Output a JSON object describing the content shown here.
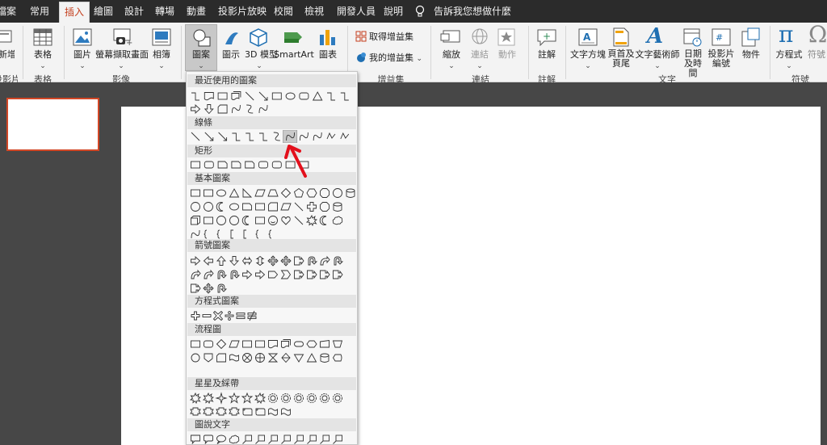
{
  "menu": {
    "tabs": [
      "檔案",
      "常用",
      "插入",
      "繪圖",
      "設計",
      "轉場",
      "動畫",
      "投影片放映",
      "校閱",
      "檢視",
      "開發人員",
      "說明"
    ],
    "active_tab": "插入",
    "tell_me": "告訴我您想做什麼"
  },
  "ribbon": {
    "buttons": {
      "new_slide": "新增投影片",
      "table": "表格",
      "pictures": "圖片",
      "screenshot": "螢幕擷取畫面",
      "album": "相簿",
      "shapes": "圖案",
      "icons": "圖示",
      "models3d": "3D 模型",
      "smartart": "SmartArt",
      "chart": "圖表",
      "get_addins": "取得增益集",
      "my_addins": "我的增益集",
      "zoom": "縮放",
      "link": "連結",
      "action": "動作",
      "comment": "註解",
      "textbox": "文字方塊",
      "header_footer": "頁首及頁尾",
      "wordart": "文字藝術師",
      "datetime": "日期及時間",
      "slide_number": "投影片編號",
      "object": "物件",
      "equation": "方程式",
      "symbol": "符號"
    },
    "groups": {
      "slides": "投影片",
      "tables": "表格",
      "images": "影像",
      "addins": "增益集",
      "links": "連結",
      "comments": "註解",
      "text": "文字",
      "symbols": "符號"
    },
    "glyphs": {
      "pi": "π",
      "omega": "Ω",
      "wordart_a": "A",
      "chart_bars": "▇"
    }
  },
  "shapes_menu": {
    "categories": [
      "最近使用的圖案",
      "線條",
      "矩形",
      "基本圖案",
      "箭號圖案",
      "方程式圖案",
      "流程圖",
      "星星及綵帶",
      "圖說文字"
    ],
    "highlighted_item": "curved-connector"
  },
  "colors": {
    "accent": "#c43e1c",
    "annotation_arrow": "#e3101c",
    "selected_thumb_border": "#d24726",
    "menubar_bg": "#2b2b2b",
    "ribbon_bg": "#f3f3f3"
  }
}
